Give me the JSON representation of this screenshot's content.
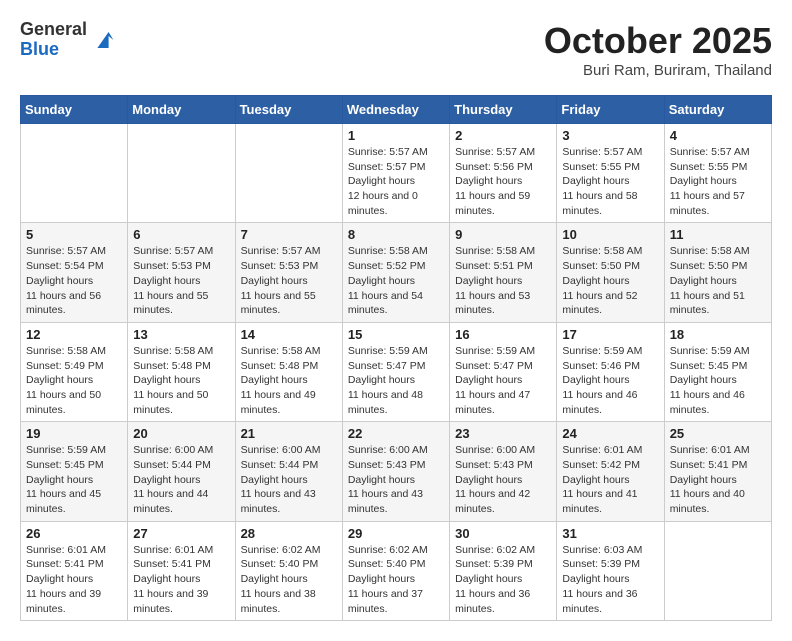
{
  "header": {
    "logo_general": "General",
    "logo_blue": "Blue",
    "month": "October 2025",
    "location": "Buri Ram, Buriram, Thailand"
  },
  "weekdays": [
    "Sunday",
    "Monday",
    "Tuesday",
    "Wednesday",
    "Thursday",
    "Friday",
    "Saturday"
  ],
  "weeks": [
    [
      null,
      null,
      null,
      {
        "day": 1,
        "sunrise": "5:57 AM",
        "sunset": "5:57 PM",
        "daylight": "12 hours and 0 minutes."
      },
      {
        "day": 2,
        "sunrise": "5:57 AM",
        "sunset": "5:56 PM",
        "daylight": "11 hours and 59 minutes."
      },
      {
        "day": 3,
        "sunrise": "5:57 AM",
        "sunset": "5:55 PM",
        "daylight": "11 hours and 58 minutes."
      },
      {
        "day": 4,
        "sunrise": "5:57 AM",
        "sunset": "5:55 PM",
        "daylight": "11 hours and 57 minutes."
      }
    ],
    [
      {
        "day": 5,
        "sunrise": "5:57 AM",
        "sunset": "5:54 PM",
        "daylight": "11 hours and 56 minutes."
      },
      {
        "day": 6,
        "sunrise": "5:57 AM",
        "sunset": "5:53 PM",
        "daylight": "11 hours and 55 minutes."
      },
      {
        "day": 7,
        "sunrise": "5:57 AM",
        "sunset": "5:53 PM",
        "daylight": "11 hours and 55 minutes."
      },
      {
        "day": 8,
        "sunrise": "5:58 AM",
        "sunset": "5:52 PM",
        "daylight": "11 hours and 54 minutes."
      },
      {
        "day": 9,
        "sunrise": "5:58 AM",
        "sunset": "5:51 PM",
        "daylight": "11 hours and 53 minutes."
      },
      {
        "day": 10,
        "sunrise": "5:58 AM",
        "sunset": "5:50 PM",
        "daylight": "11 hours and 52 minutes."
      },
      {
        "day": 11,
        "sunrise": "5:58 AM",
        "sunset": "5:50 PM",
        "daylight": "11 hours and 51 minutes."
      }
    ],
    [
      {
        "day": 12,
        "sunrise": "5:58 AM",
        "sunset": "5:49 PM",
        "daylight": "11 hours and 50 minutes."
      },
      {
        "day": 13,
        "sunrise": "5:58 AM",
        "sunset": "5:48 PM",
        "daylight": "11 hours and 50 minutes."
      },
      {
        "day": 14,
        "sunrise": "5:58 AM",
        "sunset": "5:48 PM",
        "daylight": "11 hours and 49 minutes."
      },
      {
        "day": 15,
        "sunrise": "5:59 AM",
        "sunset": "5:47 PM",
        "daylight": "11 hours and 48 minutes."
      },
      {
        "day": 16,
        "sunrise": "5:59 AM",
        "sunset": "5:47 PM",
        "daylight": "11 hours and 47 minutes."
      },
      {
        "day": 17,
        "sunrise": "5:59 AM",
        "sunset": "5:46 PM",
        "daylight": "11 hours and 46 minutes."
      },
      {
        "day": 18,
        "sunrise": "5:59 AM",
        "sunset": "5:45 PM",
        "daylight": "11 hours and 46 minutes."
      }
    ],
    [
      {
        "day": 19,
        "sunrise": "5:59 AM",
        "sunset": "5:45 PM",
        "daylight": "11 hours and 45 minutes."
      },
      {
        "day": 20,
        "sunrise": "6:00 AM",
        "sunset": "5:44 PM",
        "daylight": "11 hours and 44 minutes."
      },
      {
        "day": 21,
        "sunrise": "6:00 AM",
        "sunset": "5:44 PM",
        "daylight": "11 hours and 43 minutes."
      },
      {
        "day": 22,
        "sunrise": "6:00 AM",
        "sunset": "5:43 PM",
        "daylight": "11 hours and 43 minutes."
      },
      {
        "day": 23,
        "sunrise": "6:00 AM",
        "sunset": "5:43 PM",
        "daylight": "11 hours and 42 minutes."
      },
      {
        "day": 24,
        "sunrise": "6:01 AM",
        "sunset": "5:42 PM",
        "daylight": "11 hours and 41 minutes."
      },
      {
        "day": 25,
        "sunrise": "6:01 AM",
        "sunset": "5:41 PM",
        "daylight": "11 hours and 40 minutes."
      }
    ],
    [
      {
        "day": 26,
        "sunrise": "6:01 AM",
        "sunset": "5:41 PM",
        "daylight": "11 hours and 39 minutes."
      },
      {
        "day": 27,
        "sunrise": "6:01 AM",
        "sunset": "5:41 PM",
        "daylight": "11 hours and 39 minutes."
      },
      {
        "day": 28,
        "sunrise": "6:02 AM",
        "sunset": "5:40 PM",
        "daylight": "11 hours and 38 minutes."
      },
      {
        "day": 29,
        "sunrise": "6:02 AM",
        "sunset": "5:40 PM",
        "daylight": "11 hours and 37 minutes."
      },
      {
        "day": 30,
        "sunrise": "6:02 AM",
        "sunset": "5:39 PM",
        "daylight": "11 hours and 36 minutes."
      },
      {
        "day": 31,
        "sunrise": "6:03 AM",
        "sunset": "5:39 PM",
        "daylight": "11 hours and 36 minutes."
      },
      null
    ]
  ],
  "labels": {
    "sunrise": "Sunrise:",
    "sunset": "Sunset:",
    "daylight": "Daylight hours"
  }
}
